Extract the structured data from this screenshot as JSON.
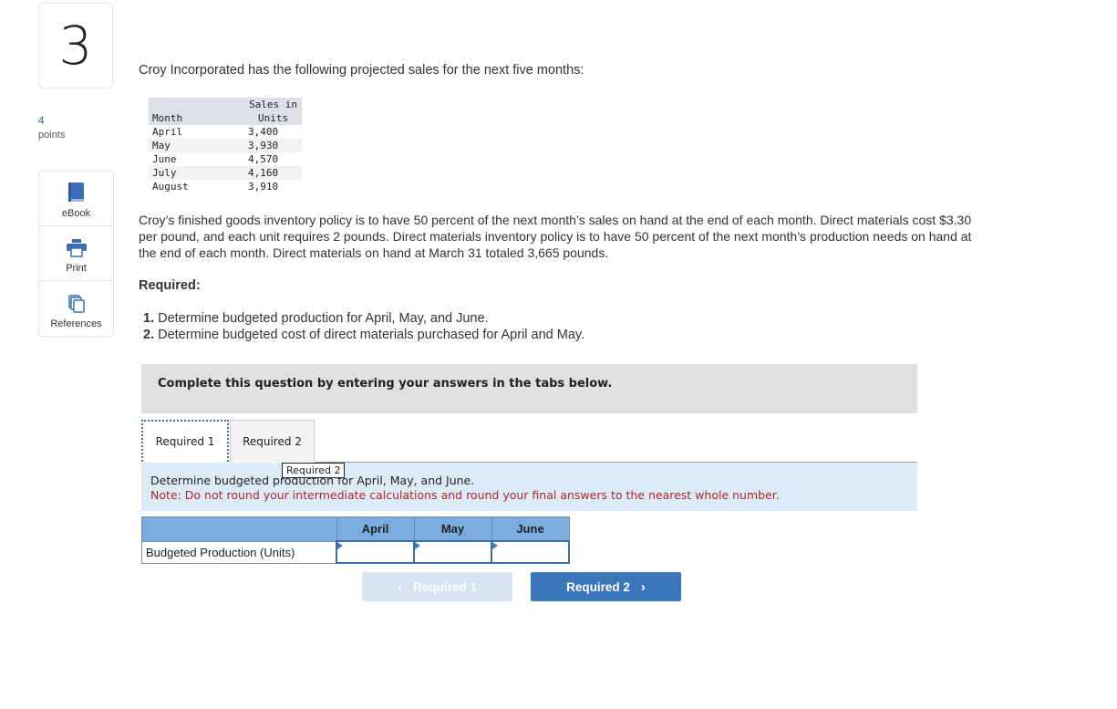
{
  "question": {
    "number": "3",
    "points_value": "4",
    "points_label": "points"
  },
  "tools": [
    {
      "label": "eBook",
      "icon": "book-icon"
    },
    {
      "label": "Print",
      "icon": "printer-icon"
    },
    {
      "label": "References",
      "icon": "documents-icon"
    }
  ],
  "intro": "Croy Incorporated has the following projected sales for the next five months:",
  "sales_table": {
    "headers": [
      "Month",
      "Sales in",
      "Units"
    ],
    "rows": [
      {
        "month": "April",
        "units": "3,400"
      },
      {
        "month": "May",
        "units": "3,930"
      },
      {
        "month": "June",
        "units": "4,570"
      },
      {
        "month": "July",
        "units": "4,160"
      },
      {
        "month": "August",
        "units": "3,910"
      }
    ]
  },
  "paragraph": "Croy’s finished goods inventory policy is to have 50 percent of the next month’s sales on hand at the end of each month. Direct materials cost $3.30 per pound, and each unit requires 2 pounds. Direct materials inventory policy is to have 50 percent of the next month’s production needs on hand at the end of each month. Direct materials on hand at March 31 totaled 3,665 pounds.",
  "required": {
    "heading": "Required:",
    "items": [
      {
        "num": "1.",
        "text": " Determine budgeted production for April, May, and June."
      },
      {
        "num": "2.",
        "text": " Determine budgeted cost of direct materials purchased for April and May."
      }
    ]
  },
  "banner": "Complete this question by entering your answers in the tabs below.",
  "tabs": [
    {
      "label": "Required 1",
      "active": true
    },
    {
      "label": "Required 2",
      "active": false
    }
  ],
  "tooltip": "Required 2",
  "instructions": {
    "line1": "Determine budgeted production for April, May, and June.",
    "note": "Note: Do not round your intermediate calculations and round your final answers to the nearest whole number."
  },
  "answer_table": {
    "columns": [
      "",
      "April",
      "May",
      "June"
    ],
    "row_label": "Budgeted Production (Units)",
    "values": [
      "",
      "",
      ""
    ]
  },
  "nav": {
    "prev_label": "Required 1",
    "next_label": "Required 2",
    "prev_icon": "chevron-left-icon",
    "next_icon": "chevron-right-icon"
  },
  "colors": {
    "accent": "#3b76bb",
    "note_red": "#b0252a",
    "instruction_bg": "#dcebf8",
    "table_header": "#7aace0"
  }
}
